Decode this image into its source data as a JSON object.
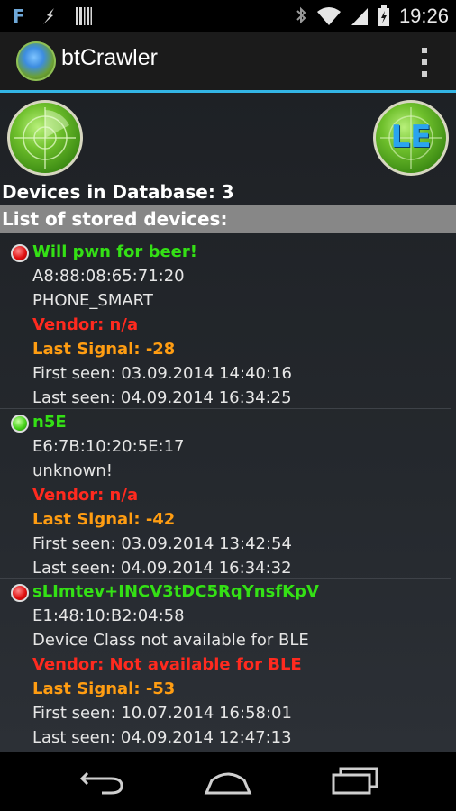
{
  "status_bar": {
    "left_icons": [
      "f-app-icon",
      "lightning-icon",
      "barcode-icon"
    ],
    "f_glyph": "F",
    "right_icons": [
      "bluetooth-icon",
      "wifi-icon",
      "signal-icon",
      "battery-charging-icon"
    ],
    "time": "19:26"
  },
  "action_bar": {
    "title": "btCrawler",
    "accent_color": "#33b5e5"
  },
  "main": {
    "radar_le_label": "LE",
    "devices_count_text": "Devices in Database: 3",
    "list_header": "List of stored devices:"
  },
  "devices": [
    {
      "status": "red",
      "name": "Will pwn for beer!",
      "address": "A8:88:08:65:71:20",
      "device_class": "PHONE_SMART",
      "vendor": "Vendor: n/a",
      "last_signal": "Last Signal: -28",
      "first_seen": "First seen: 03.09.2014 14:40:16",
      "last_seen": "Last seen: 04.09.2014 16:34:25"
    },
    {
      "status": "green",
      "name": "n5E",
      "address": "E6:7B:10:20:5E:17",
      "device_class": "unknown!",
      "vendor": "Vendor: n/a",
      "last_signal": "Last Signal: -42",
      "first_seen": "First seen: 03.09.2014 13:42:54",
      "last_seen": "Last seen: 04.09.2014 16:34:32"
    },
    {
      "status": "red",
      "name": "sLImtev+INCV3tDC5RqYnsfKpV",
      "address": "E1:48:10:B2:04:58",
      "device_class": "Device Class not available for BLE",
      "vendor": "Vendor: Not available for BLE",
      "last_signal": "Last Signal: -53",
      "first_seen": "First seen: 10.07.2014 16:58:01",
      "last_seen": "Last seen: 04.09.2014 12:47:13"
    }
  ],
  "colors": {
    "name": "#34e015",
    "vendor": "#ff2a1f",
    "signal": "#ff9d12",
    "header_bg": "#878787"
  },
  "nav_bar": [
    "back-icon",
    "home-icon",
    "recent-apps-icon"
  ]
}
